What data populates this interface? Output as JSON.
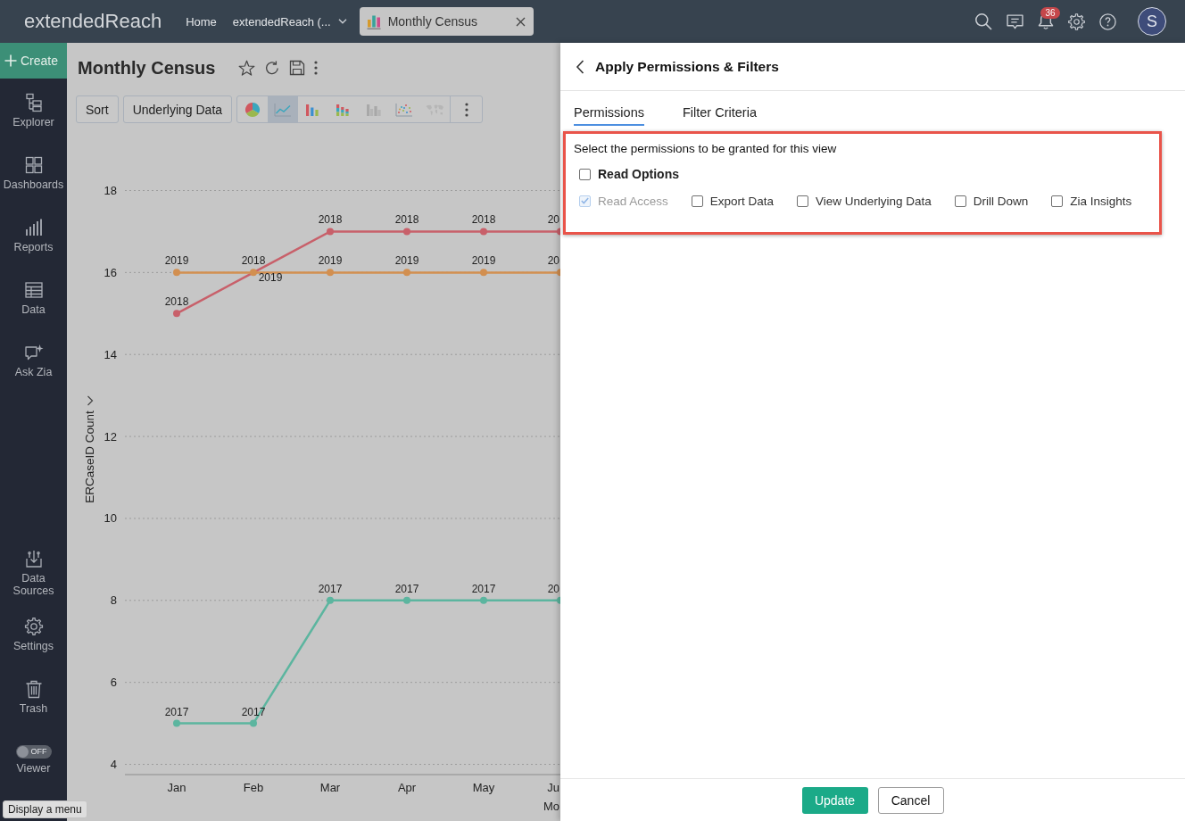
{
  "top_bar": {
    "logo": "extendedReach",
    "nav_links": [
      {
        "label": "Home",
        "kind": "link"
      },
      {
        "label": "extendedReach (...",
        "kind": "dropdown"
      }
    ],
    "open_tab": {
      "label": "Monthly Census"
    },
    "notifications": {
      "count": "36"
    },
    "avatar": {
      "initial": "S"
    }
  },
  "sidebar": {
    "create": {
      "label": "Create"
    },
    "items": [
      {
        "label": "Explorer"
      },
      {
        "label": "Dashboards"
      },
      {
        "label": "Reports"
      },
      {
        "label": "Data"
      },
      {
        "label": "Ask Zia"
      }
    ],
    "bottom_items": [
      {
        "label": "Data Sources"
      },
      {
        "label": "Settings"
      },
      {
        "label": "Trash"
      }
    ],
    "viewer": {
      "label": "Viewer",
      "state_text": "OFF",
      "on": false
    }
  },
  "report": {
    "title": "Monthly Census",
    "buttons": [
      {
        "label": "Sort"
      },
      {
        "label": "Underlying Data"
      }
    ],
    "chart_types": [
      {
        "selected": false,
        "disabled": false
      },
      {
        "selected": true,
        "disabled": false
      },
      {
        "selected": false,
        "disabled": false
      },
      {
        "selected": false,
        "disabled": false
      },
      {
        "selected": false,
        "disabled": true
      },
      {
        "selected": false,
        "disabled": false
      },
      {
        "selected": false,
        "disabled": true
      }
    ],
    "chart_data": {
      "type": "line",
      "xlabel": "Mo",
      "ylabel": "ERCaseID Count",
      "categories": [
        "Jan",
        "Feb",
        "Mar",
        "Apr",
        "May",
        "Ju"
      ],
      "series": [
        {
          "color": "#c8606a",
          "marker": "circle",
          "values": [
            15,
            16,
            17,
            17,
            17,
            17
          ]
        },
        {
          "color": "#d28f50",
          "marker": "circle",
          "values": [
            16,
            16,
            16,
            16,
            16,
            16
          ]
        },
        {
          "color": "#5cb59f",
          "marker": "circle",
          "values": [
            5,
            5,
            8,
            8,
            8,
            8
          ]
        }
      ],
      "ylim": [
        3.75,
        18
      ],
      "yticks": [
        4,
        6,
        8,
        10,
        12,
        14,
        16,
        18
      ],
      "grid": true,
      "value_labels": [
        [
          "2018",
          "2018",
          "2018",
          "2018",
          "2018",
          "20"
        ],
        [
          "2019",
          "2019",
          "2019",
          "2019",
          "2019",
          "20"
        ],
        [
          "2017",
          "2017",
          "2017",
          "2017",
          "2017",
          "20"
        ]
      ]
    }
  },
  "panel": {
    "title": "Apply Permissions & Filters",
    "tabs": [
      {
        "label": "Permissions",
        "selected": true
      },
      {
        "label": "Filter Criteria",
        "selected": false
      }
    ],
    "permissions": {
      "highlighted": true,
      "prompt": "Select the permissions to be granted for this view",
      "group": {
        "label": "Read Options",
        "checked": false
      },
      "options": [
        {
          "label": "Read Access",
          "checked": true,
          "disabled": true
        },
        {
          "label": "Export Data",
          "checked": false,
          "disabled": false
        },
        {
          "label": "View Underlying Data",
          "checked": false,
          "disabled": false
        },
        {
          "label": "Drill Down",
          "checked": false,
          "disabled": false
        },
        {
          "label": "Zia Insights",
          "checked": false,
          "disabled": false
        }
      ]
    },
    "buttons": [
      {
        "label": "Update",
        "kind": "primary"
      },
      {
        "label": "Cancel",
        "kind": "secondary"
      }
    ]
  },
  "tooltip": {
    "text": "Display a menu"
  }
}
